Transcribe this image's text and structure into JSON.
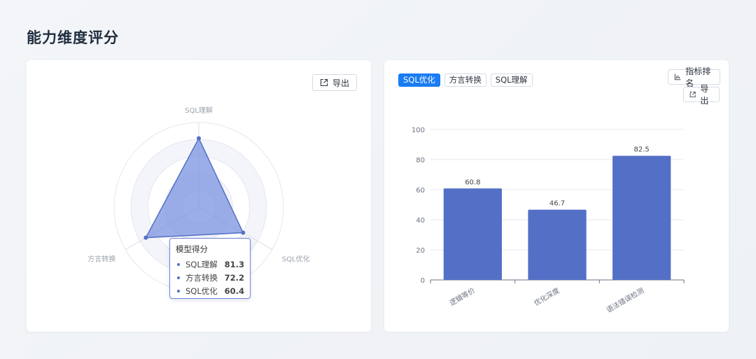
{
  "page": {
    "title": "能力维度评分"
  },
  "left_card": {
    "export_label": "导出",
    "tooltip": {
      "title": "模型得分",
      "rows": [
        {
          "label": "SQL理解",
          "value": "81.3"
        },
        {
          "label": "方言转换",
          "value": "72.2"
        },
        {
          "label": "SQL优化",
          "value": "60.4"
        }
      ]
    }
  },
  "right_card": {
    "tabs": [
      {
        "label": "SQL优化",
        "active": true
      },
      {
        "label": "方言转换",
        "active": false
      },
      {
        "label": "SQL理解",
        "active": false
      }
    ],
    "rank_label": "指标排名",
    "export_label": "导出"
  },
  "colors": {
    "accent": "#1a7cf3",
    "series": "#5470c6",
    "radar_fill": "#7b93e0"
  },
  "chart_data": [
    {
      "type": "radar",
      "indicators": [
        "SQL理解",
        "SQL优化",
        "方言转换"
      ],
      "max": 100,
      "series": [
        {
          "name": "模型得分",
          "values": [
            81.3,
            60.4,
            72.2
          ]
        }
      ]
    },
    {
      "type": "bar",
      "categories": [
        "逻辑等价",
        "优化深度",
        "语法错误检测"
      ],
      "values": [
        60.8,
        46.7,
        82.5
      ],
      "ylim": [
        0,
        100
      ],
      "yticks": [
        0,
        20,
        40,
        60,
        80,
        100
      ],
      "grid": true
    }
  ]
}
